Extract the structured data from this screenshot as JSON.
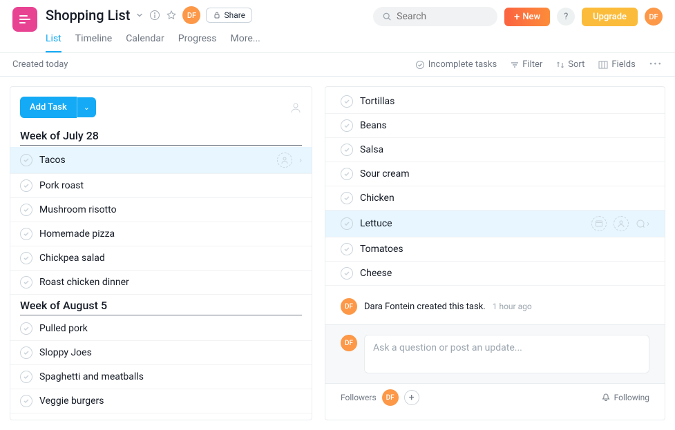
{
  "header": {
    "title": "Shopping List",
    "share": "Share",
    "user_initials": "DF",
    "tabs": [
      "List",
      "Timeline",
      "Calendar",
      "Progress",
      "More..."
    ],
    "search_placeholder": "Search",
    "new_label": "New",
    "help": "?",
    "upgrade": "Upgrade"
  },
  "toolbar": {
    "created": "Created today",
    "incomplete": "Incomplete tasks",
    "filter": "Filter",
    "sort": "Sort",
    "fields": "Fields"
  },
  "left": {
    "add_task": "Add Task",
    "sections": [
      {
        "title": "Week of July 28",
        "tasks": [
          "Tacos",
          "Pork roast",
          "Mushroom risotto",
          "Homemade pizza",
          "Chickpea salad",
          "Roast chicken dinner"
        ]
      },
      {
        "title": "Week of August 5",
        "tasks": [
          "Pulled pork",
          "Sloppy Joes",
          "Spaghetti and meatballs",
          "Veggie burgers"
        ]
      }
    ]
  },
  "right": {
    "subtasks": [
      "Tortillas",
      "Beans",
      "Salsa",
      "Sour cream",
      "Chicken",
      "Lettuce",
      "Tomatoes",
      "Cheese"
    ],
    "activity_text": "Dara Fontein created this task.",
    "activity_time": "1 hour ago",
    "comment_placeholder": "Ask a question or post an update...",
    "followers_label": "Followers",
    "following_label": "Following"
  }
}
